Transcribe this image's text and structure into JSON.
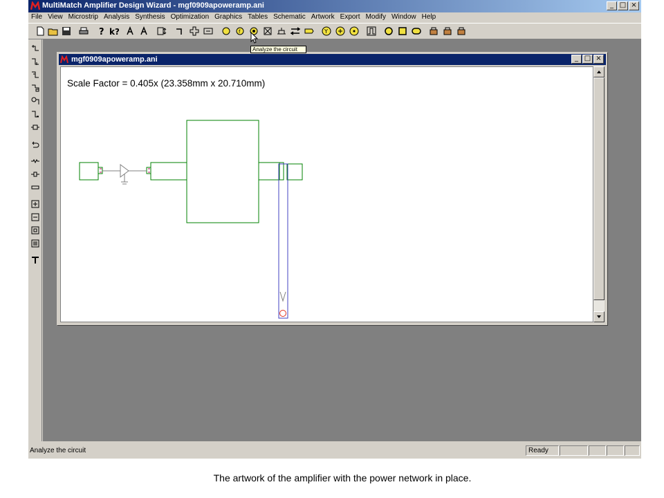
{
  "app": {
    "title": "MultiMatch Amplifier Design Wizard - mgf0909apoweramp.ani",
    "window_buttons": [
      "_",
      "□",
      "×"
    ]
  },
  "menubar": {
    "items": [
      "File",
      "View",
      "Microstrip",
      "Analysis",
      "Synthesis",
      "Optimization",
      "Graphics",
      "Tables",
      "Schematic",
      "Artwork",
      "Export",
      "Modify",
      "Window",
      "Help"
    ]
  },
  "toolbar": {
    "tooltip": "Analyze the circuit"
  },
  "document": {
    "title": "mgf0909apoweramp.ani",
    "scale_factor": "Scale Factor =  0.405x (23.358mm x 20.710mm)"
  },
  "statusbar": {
    "message": "Analyze the circuit",
    "state": "Ready"
  },
  "caption": "The artwork of the amplifier with the power network in place.",
  "colors": {
    "title_active": "#0a246a",
    "artwork_green": "#008000",
    "bias_line_blue": "#4040c0",
    "mdi_background": "#808080"
  }
}
